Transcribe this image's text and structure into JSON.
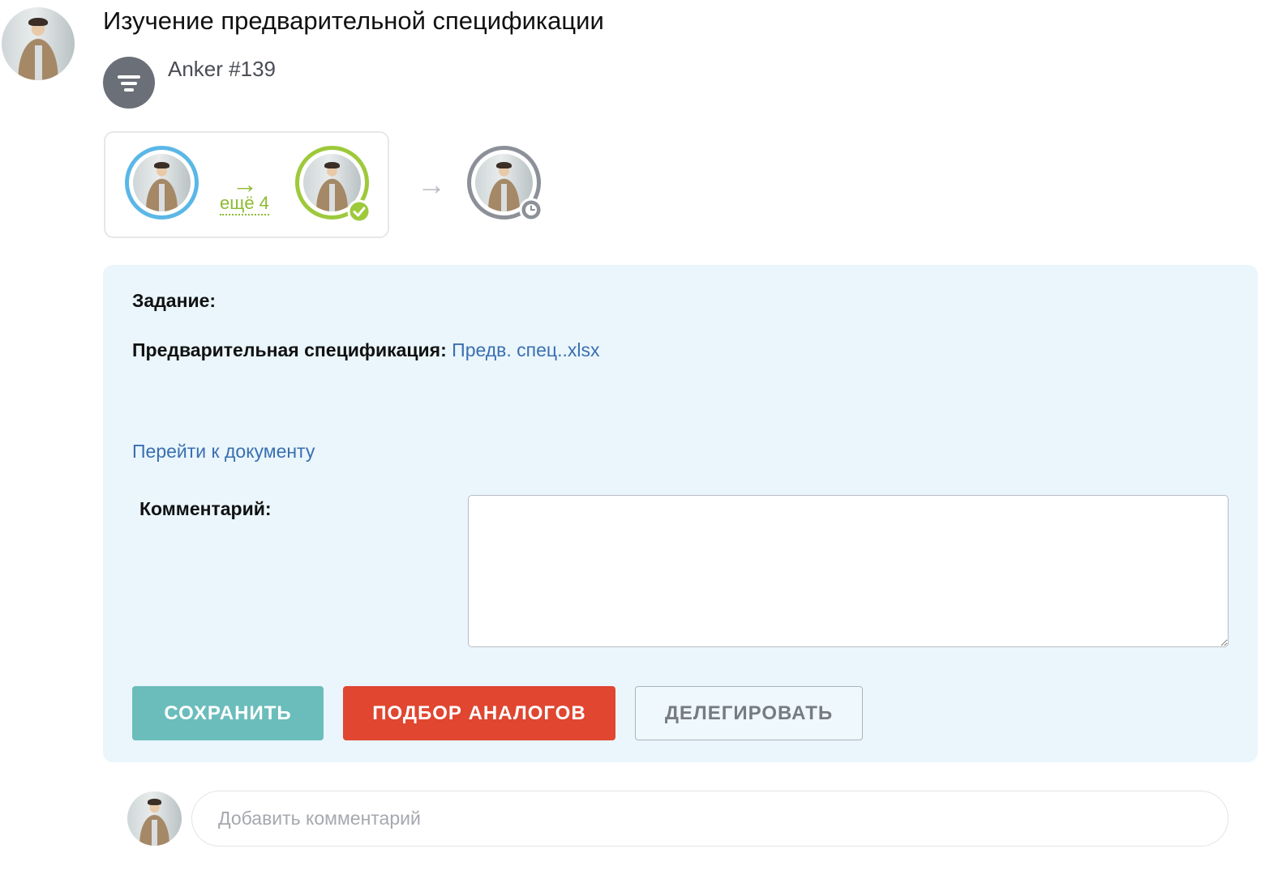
{
  "task": {
    "title": "Изучение предварительной спецификации",
    "process_name": "Anker #139"
  },
  "route": {
    "more_label": "ещё 4",
    "steps": [
      {
        "status": "current",
        "ring_color": "#5bb7e6"
      },
      {
        "status": "approved",
        "ring_color": "#9dc93b"
      },
      {
        "status": "pending",
        "ring_color": "#8c9098"
      }
    ]
  },
  "panel": {
    "task_label": "Задание:",
    "spec_label": "Предварительная спецификация:",
    "spec_file": "Предв. спец..xlsx",
    "goto_document": "Перейти к документу",
    "comment_label": "Комментарий:",
    "comment_value": ""
  },
  "actions": {
    "save_label": "СОХРАНИТЬ",
    "analogs_label": "ПОДБОР АНАЛОГОВ",
    "delegate_label": "ДЕЛЕГИРОВАТЬ"
  },
  "comments": {
    "placeholder": "Добавить комментарий"
  },
  "colors": {
    "panel_bg": "#eaf6fc",
    "save": "#6bbdbb",
    "analogs": "#e04630",
    "link": "#3a6fb0",
    "accent_green": "#8dbb31"
  }
}
